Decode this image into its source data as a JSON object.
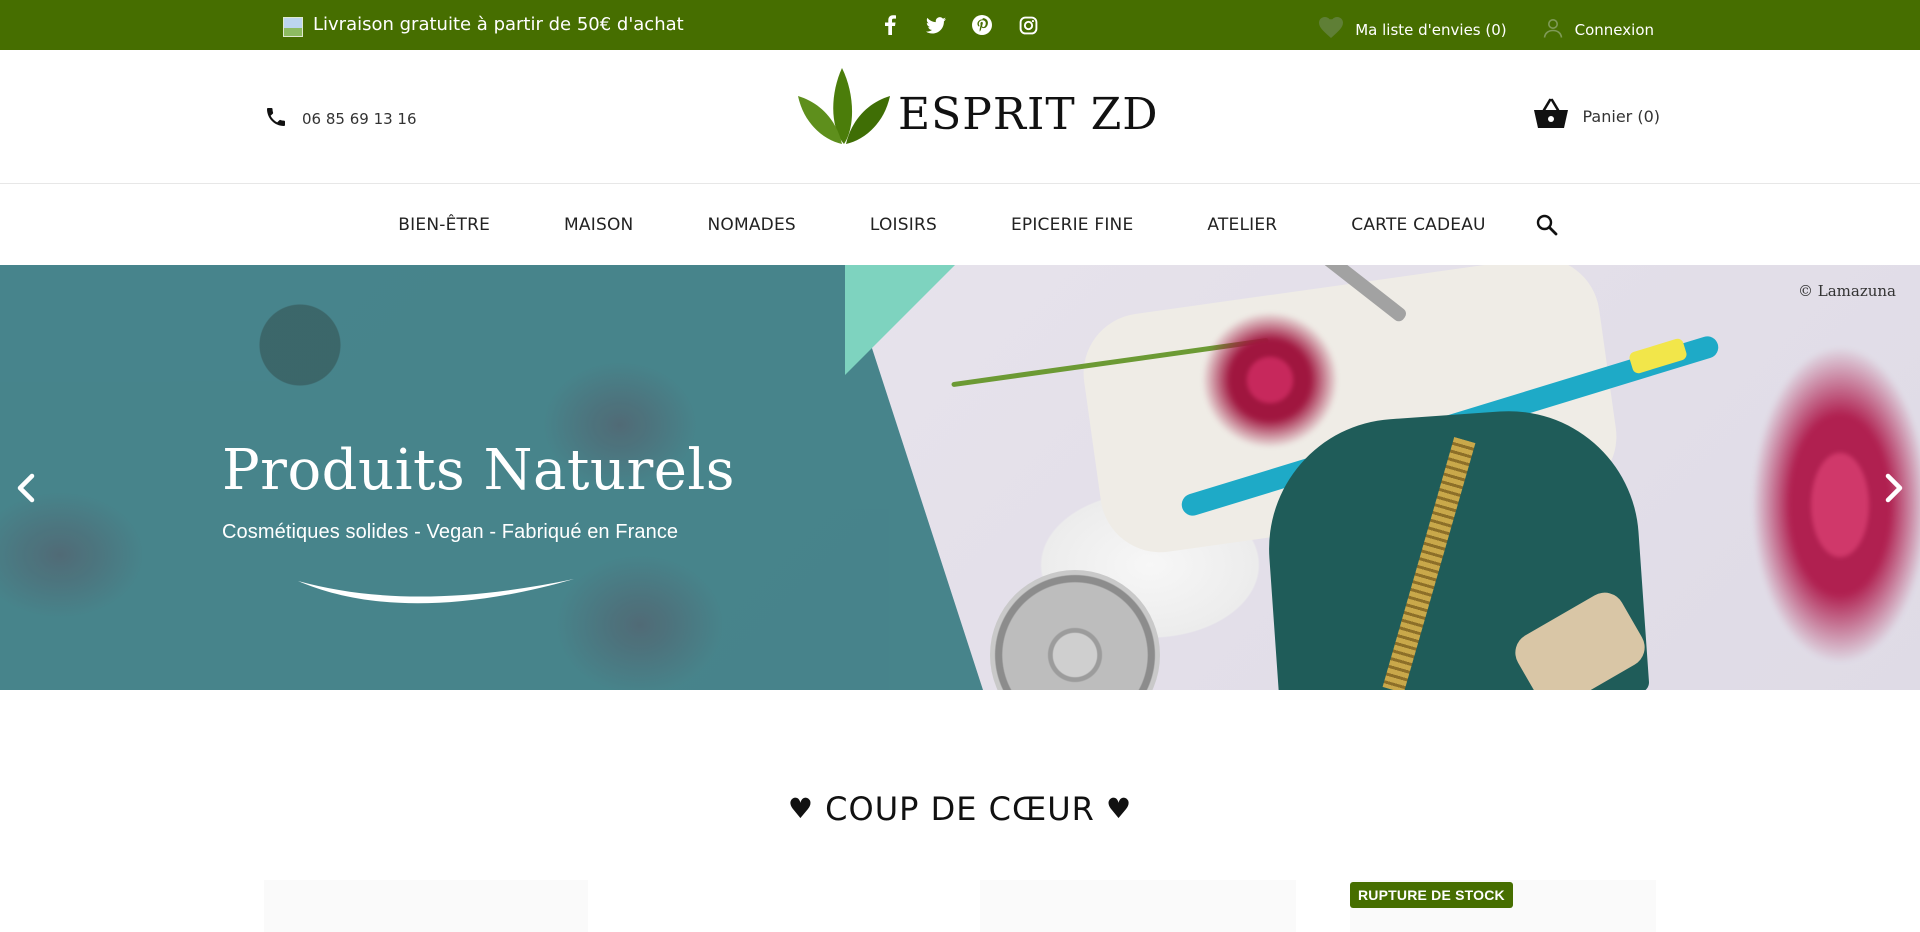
{
  "topbar": {
    "promo_text": "Livraison gratuite à partir de 50€ d'achat",
    "wishlist_label": "Ma liste d'envies (0)",
    "login_label": "Connexion",
    "socials": [
      "facebook-icon",
      "twitter-icon",
      "pinterest-icon",
      "instagram-icon"
    ]
  },
  "header": {
    "phone": "06 85 69 13 16",
    "logo_text": "ESPRIT ZD",
    "cart_label": "Panier (0)"
  },
  "nav": {
    "items": [
      "BIEN-ÊTRE",
      "MAISON",
      "NOMADES",
      "LOISIRS",
      "EPICERIE FINE",
      "ATELIER",
      "CARTE CADEAU"
    ]
  },
  "hero": {
    "title": "Produits Naturels",
    "subtitle": "Cosmétiques solides - Vegan - Fabriqué en France",
    "credit": "© Lamazuna"
  },
  "section": {
    "title": "COUP DE CŒUR",
    "badge": "RUPTURE DE STOCK"
  },
  "colors": {
    "brand_green": "#466e00",
    "hero_teal": "#3f7f86"
  }
}
